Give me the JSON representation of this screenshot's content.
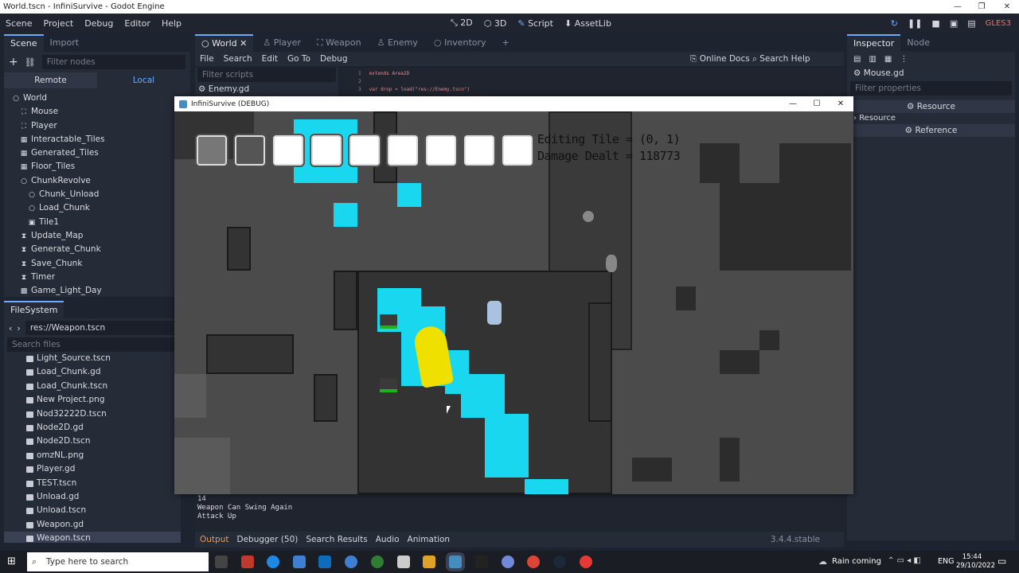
{
  "window_title": "World.tscn - InfiniSurvive - Godot Engine",
  "menu": [
    "Scene",
    "Project",
    "Debug",
    "Editor",
    "Help"
  ],
  "workspace_buttons": [
    "2D",
    "3D",
    "Script",
    "AssetLib"
  ],
  "renderer": "GLES3",
  "scene_dock": {
    "tabs": [
      "Scene",
      "Import"
    ],
    "filter_placeholder": "Filter nodes",
    "remote_label": "Remote",
    "local_label": "Local",
    "nodes": [
      {
        "name": "World",
        "indent": 0,
        "icon": "○"
      },
      {
        "name": "Mouse",
        "indent": 1,
        "icon": "⛶"
      },
      {
        "name": "Player",
        "indent": 1,
        "icon": "⛶"
      },
      {
        "name": "Interactable_Tiles",
        "indent": 1,
        "icon": "▦"
      },
      {
        "name": "Generated_Tiles",
        "indent": 1,
        "icon": "▦"
      },
      {
        "name": "Floor_Tiles",
        "indent": 1,
        "icon": "▦"
      },
      {
        "name": "ChunkRevolve",
        "indent": 1,
        "icon": "○"
      },
      {
        "name": "Chunk_Unload",
        "indent": 2,
        "icon": "○"
      },
      {
        "name": "Load_Chunk",
        "indent": 2,
        "icon": "○"
      },
      {
        "name": "Tile1",
        "indent": 2,
        "icon": "▣"
      },
      {
        "name": "Update_Map",
        "indent": 1,
        "icon": "⧗"
      },
      {
        "name": "Generate_Chunk",
        "indent": 1,
        "icon": "⧗"
      },
      {
        "name": "Save_Chunk",
        "indent": 1,
        "icon": "⧗"
      },
      {
        "name": "Timer",
        "indent": 1,
        "icon": "⧗"
      },
      {
        "name": "Game_Light_Day",
        "indent": 1,
        "icon": "▩"
      }
    ]
  },
  "filesystem": {
    "title": "FileSystem",
    "path": "res://Weapon.tscn",
    "search_placeholder": "Search files",
    "files": [
      "Light_Source.tscn",
      "Load_Chunk.gd",
      "Load_Chunk.tscn",
      "New Project.png",
      "Nod32222D.tscn",
      "Node2D.gd",
      "Node2D.tscn",
      "omzNL.png",
      "Player.gd",
      "TEST.tscn",
      "Unload.gd",
      "Unload.tscn",
      "Weapon.gd",
      "Weapon.tscn"
    ],
    "selected": "Weapon.tscn"
  },
  "editor_tabs": [
    "World",
    "Player",
    "Weapon",
    "Enemy",
    "Inventory"
  ],
  "script_menu": [
    "File",
    "Search",
    "Edit",
    "Go To",
    "Debug"
  ],
  "script_links": [
    "Online Docs",
    "Search Help"
  ],
  "filter_scripts_placeholder": "Filter scripts",
  "script_list": [
    "Enemy.gd"
  ],
  "code_lines": [
    {
      "n": "1",
      "t": "extends Area2D"
    },
    {
      "n": "2",
      "t": ""
    },
    {
      "n": "3",
      "t": "var drop = load(\"res://Enemy.tscn\")"
    }
  ],
  "inspector": {
    "tabs": [
      "Inspector",
      "Node"
    ],
    "file": "Mouse.gd",
    "filter_placeholder": "Filter properties",
    "sections": [
      "Resource",
      "Resource",
      "Reference"
    ]
  },
  "game_window": {
    "title": "InfiniSurvive (DEBUG)",
    "hud_line1": "Editing Tile = (0, 1)",
    "hud_line2": "Damage Dealt = 118773"
  },
  "output": {
    "lines": [
      "14",
      "Weapon Can Swing Again",
      "Attack Up"
    ],
    "tabs": [
      "Output",
      "Debugger (50)",
      "Search Results",
      "Audio",
      "Animation"
    ],
    "version": "3.4.4.stable"
  },
  "taskbar": {
    "search_placeholder": "Type here to search",
    "weather": "Rain coming",
    "lang": "ENG",
    "time": "15:44",
    "date": "29/10/2022"
  }
}
